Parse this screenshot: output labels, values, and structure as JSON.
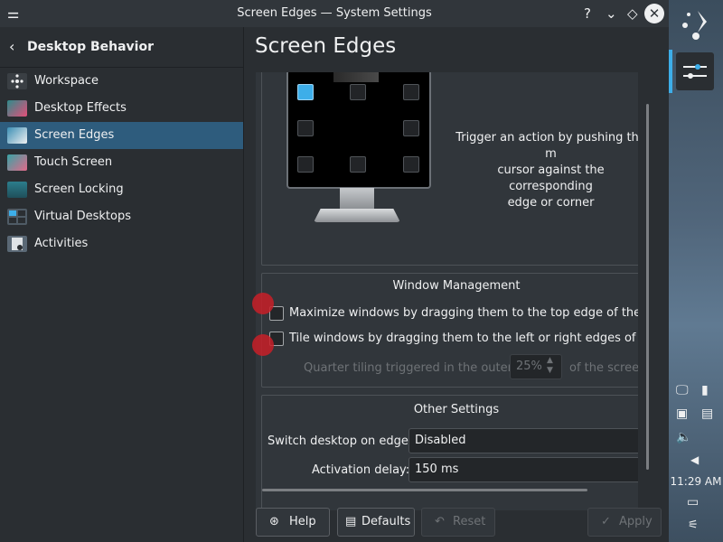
{
  "window": {
    "title": "Screen Edges — System Settings"
  },
  "titlebar_icons": [
    "menu-icon",
    "help-icon",
    "minimize-icon",
    "keep-above-icon",
    "close-icon"
  ],
  "titlebar_glyphs": {
    "help": "?",
    "minimize": "⌄",
    "keep_above": "◇",
    "close": "✕"
  },
  "sidebar": {
    "back_label": "Desktop Behavior",
    "items": [
      {
        "label": "Workspace",
        "icon": "workspace-icon",
        "color": "#3a3f44"
      },
      {
        "label": "Desktop Effects",
        "icon": "desktop-effects-icon",
        "color": "#2e8b8b"
      },
      {
        "label": "Screen Edges",
        "icon": "screen-edges-icon",
        "color": "#3c8fb5",
        "selected": true
      },
      {
        "label": "Touch Screen",
        "icon": "touch-screen-icon",
        "color": "#38a3a5"
      },
      {
        "label": "Screen Locking",
        "icon": "screen-locking-icon",
        "color": "#2c7d8c"
      },
      {
        "label": "Virtual Desktops",
        "icon": "virtual-desktops-icon",
        "color": "#4f5b66"
      },
      {
        "label": "Activities",
        "icon": "activities-icon",
        "color": "#5a6875"
      }
    ]
  },
  "main": {
    "page_title": "Screen Edges",
    "description": "Trigger an action by pushing the mouse cursor against the corresponding screen edge or corner",
    "description_lines": [
      "Trigger an action by pushing the m",
      "cursor against the corresponding",
      "edge or corner"
    ],
    "window_management": {
      "title": "Window Management",
      "maximize_label": "Maximize windows by dragging them to the top edge of the screen",
      "tile_label": "Tile windows by dragging them to the left or right edges of the screen",
      "quarter_prefix": "Quarter tiling triggered in the outer",
      "quarter_value": "25%",
      "quarter_suffix": "of the screen"
    },
    "other_settings": {
      "title": "Other Settings",
      "switch_label": "Switch desktop on edge:",
      "switch_value": "Disabled",
      "activation_label": "Activation delay:",
      "activation_value": "150 ms"
    }
  },
  "buttons": {
    "help": "Help",
    "defaults": "Defaults",
    "reset": "Reset",
    "apply": "Apply"
  },
  "panel": {
    "time": "11:29 AM",
    "accent": "#3daee9"
  },
  "colors": {
    "selected_bg": "#2e5c7d",
    "accent": "#3daee9",
    "window_bg": "#2a2e32",
    "click_marker": "#c81e28"
  }
}
